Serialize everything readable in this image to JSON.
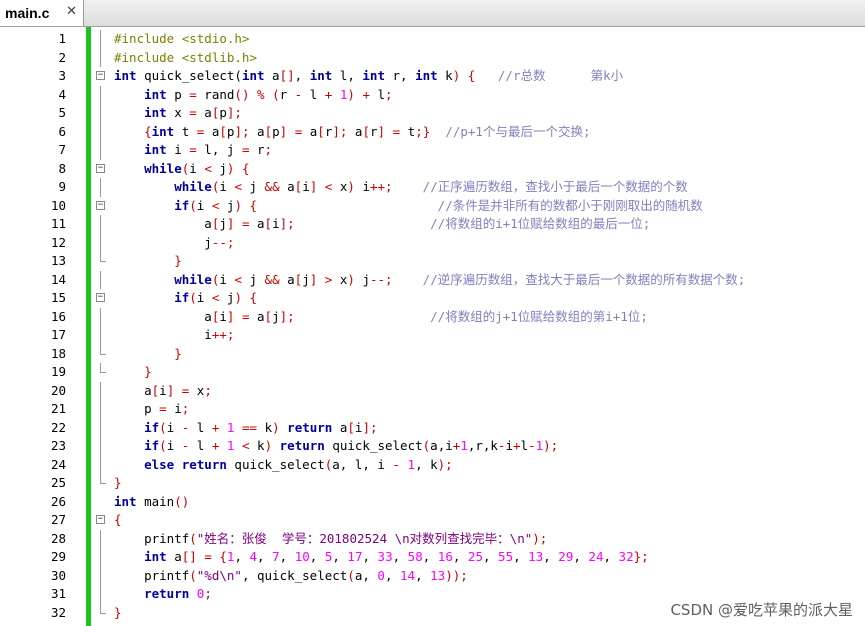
{
  "tab": {
    "label": "main.c",
    "close_glyph": "✕"
  },
  "watermark": "CSDN @爱吃苹果的派大星",
  "lines": [
    {
      "n": "1",
      "indent": 0,
      "fold": "line",
      "tokens": [
        [
          "pp",
          "#include <stdio.h>"
        ]
      ]
    },
    {
      "n": "2",
      "indent": 0,
      "fold": "line",
      "tokens": [
        [
          "pp",
          "#include <stdlib.h>"
        ]
      ]
    },
    {
      "n": "3",
      "indent": 0,
      "fold": "box",
      "tokens": [
        [
          "kw",
          "int"
        ],
        [
          "id",
          " quick_select("
        ],
        [
          "kw",
          "int"
        ],
        [
          "id",
          " a"
        ],
        [
          "op",
          "[]"
        ],
        [
          "id",
          ", "
        ],
        [
          "kw",
          "int"
        ],
        [
          "id",
          " l, "
        ],
        [
          "kw",
          "int"
        ],
        [
          "id",
          " r, "
        ],
        [
          "kw",
          "int"
        ],
        [
          "id",
          " k"
        ],
        [
          "op",
          ")"
        ],
        [
          "id",
          " "
        ],
        [
          "op",
          "{"
        ],
        [
          "id",
          "   "
        ],
        [
          "cmt",
          "//r总数      第k小"
        ]
      ]
    },
    {
      "n": "4",
      "indent": 1,
      "fold": "line",
      "tokens": [
        [
          "kw",
          "int"
        ],
        [
          "id",
          " p "
        ],
        [
          "op",
          "="
        ],
        [
          "id",
          " rand"
        ],
        [
          "op",
          "()"
        ],
        [
          "id",
          " "
        ],
        [
          "op",
          "%"
        ],
        [
          "id",
          " "
        ],
        [
          "op",
          "("
        ],
        [
          "id",
          "r "
        ],
        [
          "op",
          "-"
        ],
        [
          "id",
          " l "
        ],
        [
          "op",
          "+"
        ],
        [
          "id",
          " "
        ],
        [
          "num",
          "1"
        ],
        [
          "op",
          ")"
        ],
        [
          "id",
          " "
        ],
        [
          "op",
          "+"
        ],
        [
          "id",
          " l"
        ],
        [
          "op",
          ";"
        ]
      ]
    },
    {
      "n": "5",
      "indent": 1,
      "fold": "line",
      "tokens": [
        [
          "kw",
          "int"
        ],
        [
          "id",
          " x "
        ],
        [
          "op",
          "="
        ],
        [
          "id",
          " a"
        ],
        [
          "op",
          "["
        ],
        [
          "id",
          "p"
        ],
        [
          "op",
          "];"
        ]
      ]
    },
    {
      "n": "6",
      "indent": 1,
      "fold": "line",
      "tokens": [
        [
          "op",
          "{"
        ],
        [
          "kw",
          "int"
        ],
        [
          "id",
          " t "
        ],
        [
          "op",
          "="
        ],
        [
          "id",
          " a"
        ],
        [
          "op",
          "["
        ],
        [
          "id",
          "p"
        ],
        [
          "op",
          "];"
        ],
        [
          "id",
          " a"
        ],
        [
          "op",
          "["
        ],
        [
          "id",
          "p"
        ],
        [
          "op",
          "]"
        ],
        [
          "id",
          " "
        ],
        [
          "op",
          "="
        ],
        [
          "id",
          " a"
        ],
        [
          "op",
          "["
        ],
        [
          "id",
          "r"
        ],
        [
          "op",
          "];"
        ],
        [
          "id",
          " a"
        ],
        [
          "op",
          "["
        ],
        [
          "id",
          "r"
        ],
        [
          "op",
          "]"
        ],
        [
          "id",
          " "
        ],
        [
          "op",
          "="
        ],
        [
          "id",
          " t"
        ],
        [
          "op",
          ";}"
        ],
        [
          "id",
          "  "
        ],
        [
          "cmt",
          "//p+1个与最后一个交换;"
        ]
      ]
    },
    {
      "n": "7",
      "indent": 1,
      "fold": "line",
      "tokens": [
        [
          "kw",
          "int"
        ],
        [
          "id",
          " i "
        ],
        [
          "op",
          "="
        ],
        [
          "id",
          " l, j "
        ],
        [
          "op",
          "="
        ],
        [
          "id",
          " r"
        ],
        [
          "op",
          ";"
        ]
      ]
    },
    {
      "n": "8",
      "indent": 1,
      "fold": "box",
      "tokens": [
        [
          "kw",
          "while"
        ],
        [
          "op",
          "("
        ],
        [
          "id",
          "i "
        ],
        [
          "op",
          "<"
        ],
        [
          "id",
          " j"
        ],
        [
          "op",
          ")"
        ],
        [
          "id",
          " "
        ],
        [
          "op",
          "{"
        ]
      ]
    },
    {
      "n": "9",
      "indent": 2,
      "fold": "line",
      "tokens": [
        [
          "kw",
          "while"
        ],
        [
          "op",
          "("
        ],
        [
          "id",
          "i "
        ],
        [
          "op",
          "<"
        ],
        [
          "id",
          " j "
        ],
        [
          "op",
          "&&"
        ],
        [
          "id",
          " a"
        ],
        [
          "op",
          "["
        ],
        [
          "id",
          "i"
        ],
        [
          "op",
          "]"
        ],
        [
          "id",
          " "
        ],
        [
          "op",
          "<"
        ],
        [
          "id",
          " x"
        ],
        [
          "op",
          ")"
        ],
        [
          "id",
          " i"
        ],
        [
          "op",
          "++;"
        ],
        [
          "id",
          "    "
        ],
        [
          "cmt",
          "//正序遍历数组，查找小于最后一个数据的个数"
        ]
      ]
    },
    {
      "n": "10",
      "indent": 2,
      "fold": "box",
      "tokens": [
        [
          "kw",
          "if"
        ],
        [
          "op",
          "("
        ],
        [
          "id",
          "i "
        ],
        [
          "op",
          "<"
        ],
        [
          "id",
          " j"
        ],
        [
          "op",
          ")"
        ],
        [
          "id",
          " "
        ],
        [
          "op",
          "{"
        ],
        [
          "id",
          "                        "
        ],
        [
          "cmt",
          "//条件是并非所有的数都小于刚刚取出的随机数"
        ]
      ]
    },
    {
      "n": "11",
      "indent": 3,
      "fold": "line",
      "tokens": [
        [
          "id",
          "a"
        ],
        [
          "op",
          "["
        ],
        [
          "id",
          "j"
        ],
        [
          "op",
          "]"
        ],
        [
          "id",
          " "
        ],
        [
          "op",
          "="
        ],
        [
          "id",
          " a"
        ],
        [
          "op",
          "["
        ],
        [
          "id",
          "i"
        ],
        [
          "op",
          "];"
        ],
        [
          "id",
          "                  "
        ],
        [
          "cmt",
          "//将数组的i+1位赋给数组的最后一位;"
        ]
      ]
    },
    {
      "n": "12",
      "indent": 3,
      "fold": "line",
      "tokens": [
        [
          "id",
          "j"
        ],
        [
          "op",
          "--;"
        ]
      ]
    },
    {
      "n": "13",
      "indent": 2,
      "fold": "end",
      "tokens": [
        [
          "op",
          "}"
        ]
      ]
    },
    {
      "n": "14",
      "indent": 2,
      "fold": "line",
      "tokens": [
        [
          "kw",
          "while"
        ],
        [
          "op",
          "("
        ],
        [
          "id",
          "i "
        ],
        [
          "op",
          "<"
        ],
        [
          "id",
          " j "
        ],
        [
          "op",
          "&&"
        ],
        [
          "id",
          " a"
        ],
        [
          "op",
          "["
        ],
        [
          "id",
          "j"
        ],
        [
          "op",
          "]"
        ],
        [
          "id",
          " "
        ],
        [
          "op",
          ">"
        ],
        [
          "id",
          " x"
        ],
        [
          "op",
          ")"
        ],
        [
          "id",
          " j"
        ],
        [
          "op",
          "--;"
        ],
        [
          "id",
          "    "
        ],
        [
          "cmt",
          "//逆序遍历数组，查找大于最后一个数据的所有数据个数;"
        ]
      ]
    },
    {
      "n": "15",
      "indent": 2,
      "fold": "box",
      "tokens": [
        [
          "kw",
          "if"
        ],
        [
          "op",
          "("
        ],
        [
          "id",
          "i "
        ],
        [
          "op",
          "<"
        ],
        [
          "id",
          " j"
        ],
        [
          "op",
          ")"
        ],
        [
          "id",
          " "
        ],
        [
          "op",
          "{"
        ]
      ]
    },
    {
      "n": "16",
      "indent": 3,
      "fold": "line",
      "tokens": [
        [
          "id",
          "a"
        ],
        [
          "op",
          "["
        ],
        [
          "id",
          "i"
        ],
        [
          "op",
          "]"
        ],
        [
          "id",
          " "
        ],
        [
          "op",
          "="
        ],
        [
          "id",
          " a"
        ],
        [
          "op",
          "["
        ],
        [
          "id",
          "j"
        ],
        [
          "op",
          "];"
        ],
        [
          "id",
          "                  "
        ],
        [
          "cmt",
          "//将数组的j+1位赋给数组的第i+1位;"
        ]
      ]
    },
    {
      "n": "17",
      "indent": 3,
      "fold": "line",
      "tokens": [
        [
          "id",
          "i"
        ],
        [
          "op",
          "++;"
        ]
      ]
    },
    {
      "n": "18",
      "indent": 2,
      "fold": "end",
      "tokens": [
        [
          "op",
          "}"
        ]
      ]
    },
    {
      "n": "19",
      "indent": 1,
      "fold": "end",
      "tokens": [
        [
          "op",
          "}"
        ]
      ]
    },
    {
      "n": "20",
      "indent": 1,
      "fold": "line",
      "tokens": [
        [
          "id",
          "a"
        ],
        [
          "op",
          "["
        ],
        [
          "id",
          "i"
        ],
        [
          "op",
          "]"
        ],
        [
          "id",
          " "
        ],
        [
          "op",
          "="
        ],
        [
          "id",
          " x"
        ],
        [
          "op",
          ";"
        ]
      ]
    },
    {
      "n": "21",
      "indent": 1,
      "fold": "line",
      "tokens": [
        [
          "id",
          "p "
        ],
        [
          "op",
          "="
        ],
        [
          "id",
          " i"
        ],
        [
          "op",
          ";"
        ]
      ]
    },
    {
      "n": "22",
      "indent": 1,
      "fold": "line",
      "tokens": [
        [
          "kw",
          "if"
        ],
        [
          "op",
          "("
        ],
        [
          "id",
          "i "
        ],
        [
          "op",
          "-"
        ],
        [
          "id",
          " l "
        ],
        [
          "op",
          "+"
        ],
        [
          "id",
          " "
        ],
        [
          "num",
          "1"
        ],
        [
          "id",
          " "
        ],
        [
          "op",
          "=="
        ],
        [
          "id",
          " k"
        ],
        [
          "op",
          ")"
        ],
        [
          "id",
          " "
        ],
        [
          "kw",
          "return"
        ],
        [
          "id",
          " a"
        ],
        [
          "op",
          "["
        ],
        [
          "id",
          "i"
        ],
        [
          "op",
          "];"
        ]
      ]
    },
    {
      "n": "23",
      "indent": 1,
      "fold": "line",
      "tokens": [
        [
          "kw",
          "if"
        ],
        [
          "op",
          "("
        ],
        [
          "id",
          "i "
        ],
        [
          "op",
          "-"
        ],
        [
          "id",
          " l "
        ],
        [
          "op",
          "+"
        ],
        [
          "id",
          " "
        ],
        [
          "num",
          "1"
        ],
        [
          "id",
          " "
        ],
        [
          "op",
          "<"
        ],
        [
          "id",
          " k"
        ],
        [
          "op",
          ")"
        ],
        [
          "id",
          " "
        ],
        [
          "kw",
          "return"
        ],
        [
          "id",
          " quick_select"
        ],
        [
          "op",
          "("
        ],
        [
          "id",
          "a,i"
        ],
        [
          "op",
          "+"
        ],
        [
          "num",
          "1"
        ],
        [
          "id",
          ",r,k"
        ],
        [
          "op",
          "-"
        ],
        [
          "id",
          "i"
        ],
        [
          "op",
          "+"
        ],
        [
          "id",
          "l"
        ],
        [
          "op",
          "-"
        ],
        [
          "num",
          "1"
        ],
        [
          "op",
          ");"
        ]
      ]
    },
    {
      "n": "24",
      "indent": 1,
      "fold": "line",
      "tokens": [
        [
          "kw",
          "else"
        ],
        [
          "id",
          " "
        ],
        [
          "kw",
          "return"
        ],
        [
          "id",
          " quick_select"
        ],
        [
          "op",
          "("
        ],
        [
          "id",
          "a, l, i "
        ],
        [
          "op",
          "-"
        ],
        [
          "id",
          " "
        ],
        [
          "num",
          "1"
        ],
        [
          "id",
          ", k"
        ],
        [
          "op",
          ");"
        ]
      ]
    },
    {
      "n": "25",
      "indent": 0,
      "fold": "end",
      "tokens": [
        [
          "op",
          "}"
        ]
      ]
    },
    {
      "n": "26",
      "indent": 0,
      "fold": "none",
      "tokens": [
        [
          "kw",
          "int"
        ],
        [
          "id",
          " main"
        ],
        [
          "op",
          "()"
        ]
      ]
    },
    {
      "n": "27",
      "indent": 0,
      "fold": "box",
      "tokens": [
        [
          "op",
          "{"
        ]
      ]
    },
    {
      "n": "28",
      "indent": 1,
      "fold": "line",
      "tokens": [
        [
          "id",
          "printf"
        ],
        [
          "op",
          "("
        ],
        [
          "str",
          "\"姓名：张俊  学号：201802524 \\n对数列查找完毕：\\n\""
        ],
        [
          "op",
          ");"
        ]
      ]
    },
    {
      "n": "29",
      "indent": 1,
      "fold": "line",
      "tokens": [
        [
          "kw",
          "int"
        ],
        [
          "id",
          " a"
        ],
        [
          "op",
          "[]"
        ],
        [
          "id",
          " "
        ],
        [
          "op",
          "="
        ],
        [
          "id",
          " "
        ],
        [
          "op",
          "{"
        ],
        [
          "num",
          "1"
        ],
        [
          "id",
          ", "
        ],
        [
          "num",
          "4"
        ],
        [
          "id",
          ", "
        ],
        [
          "num",
          "7"
        ],
        [
          "id",
          ", "
        ],
        [
          "num",
          "10"
        ],
        [
          "id",
          ", "
        ],
        [
          "num",
          "5"
        ],
        [
          "id",
          ", "
        ],
        [
          "num",
          "17"
        ],
        [
          "id",
          ", "
        ],
        [
          "num",
          "33"
        ],
        [
          "id",
          ", "
        ],
        [
          "num",
          "58"
        ],
        [
          "id",
          ", "
        ],
        [
          "num",
          "16"
        ],
        [
          "id",
          ", "
        ],
        [
          "num",
          "25"
        ],
        [
          "id",
          ", "
        ],
        [
          "num",
          "55"
        ],
        [
          "id",
          ", "
        ],
        [
          "num",
          "13"
        ],
        [
          "id",
          ", "
        ],
        [
          "num",
          "29"
        ],
        [
          "id",
          ", "
        ],
        [
          "num",
          "24"
        ],
        [
          "id",
          ", "
        ],
        [
          "num",
          "32"
        ],
        [
          "op",
          "};"
        ]
      ]
    },
    {
      "n": "30",
      "indent": 1,
      "fold": "line",
      "tokens": [
        [
          "id",
          "printf"
        ],
        [
          "op",
          "("
        ],
        [
          "str",
          "\"%d\\n\""
        ],
        [
          "id",
          ", quick_select"
        ],
        [
          "op",
          "("
        ],
        [
          "id",
          "a, "
        ],
        [
          "num",
          "0"
        ],
        [
          "id",
          ", "
        ],
        [
          "num",
          "14"
        ],
        [
          "id",
          ", "
        ],
        [
          "num",
          "13"
        ],
        [
          "op",
          "));"
        ]
      ]
    },
    {
      "n": "31",
      "indent": 1,
      "fold": "line",
      "tokens": [
        [
          "kw",
          "return"
        ],
        [
          "id",
          " "
        ],
        [
          "num",
          "0"
        ],
        [
          "op",
          ";"
        ]
      ]
    },
    {
      "n": "32",
      "indent": 0,
      "fold": "end",
      "tokens": [
        [
          "op",
          "}"
        ]
      ]
    }
  ]
}
